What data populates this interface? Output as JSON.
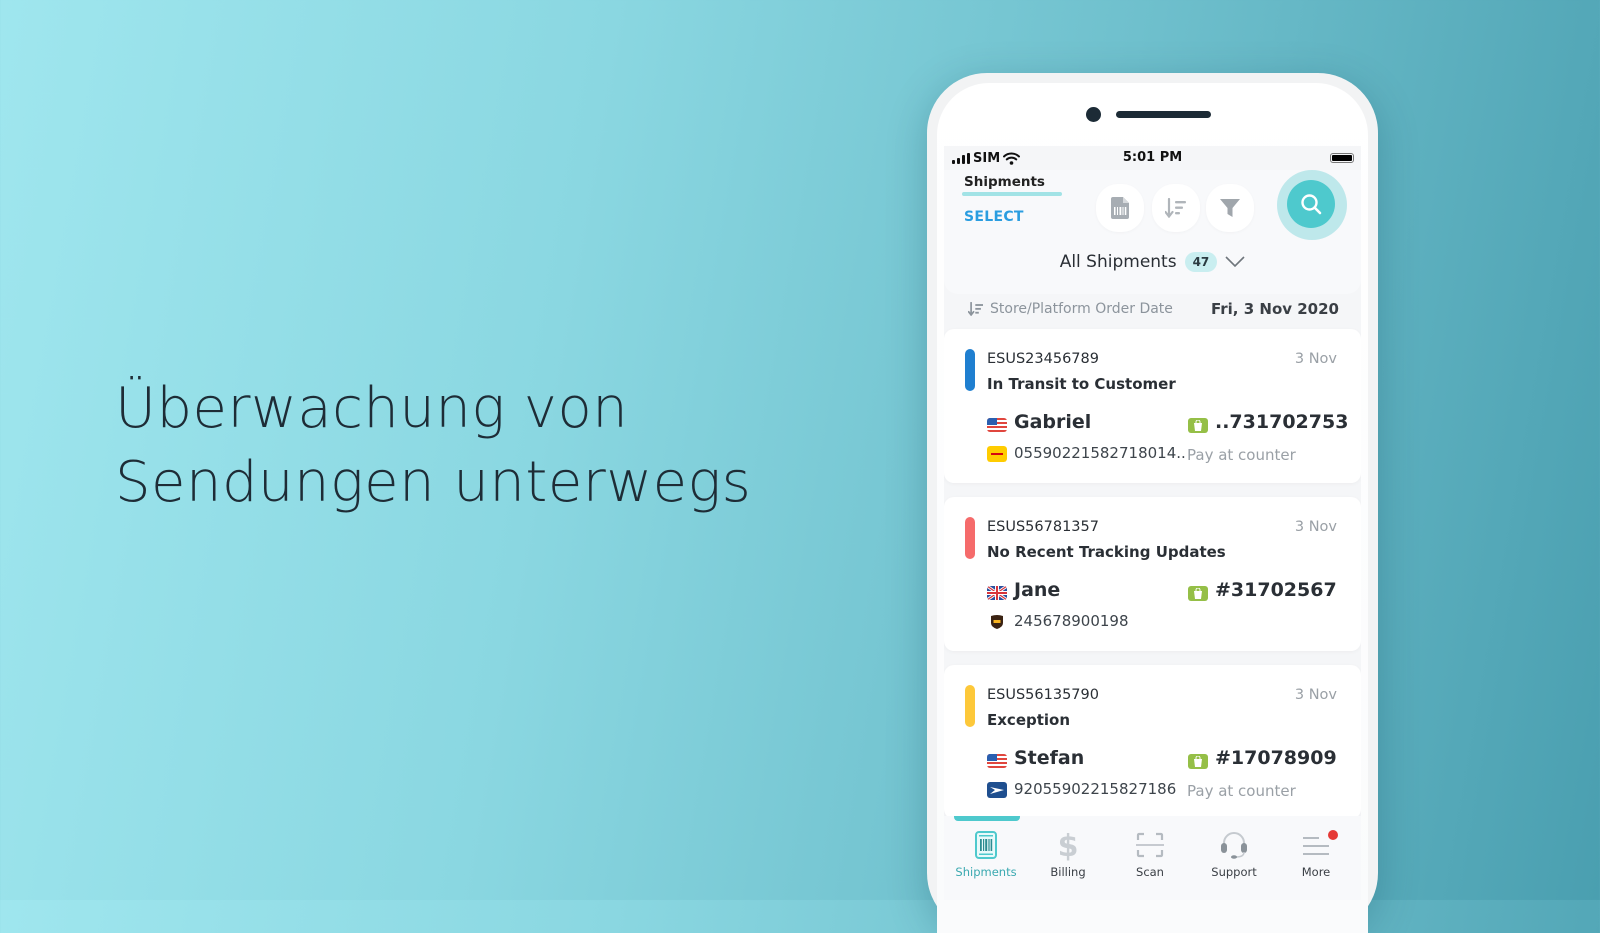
{
  "headline": {
    "line1": "Überwachung von",
    "line2": "Sendungen unterwegs"
  },
  "status_bar": {
    "carrier": "SIM",
    "time": "5:01 PM",
    "icons": [
      "signal-icon",
      "wifi-icon",
      "battery-icon"
    ]
  },
  "header": {
    "tab_label": "Shipments",
    "select_label": "SELECT",
    "tools": [
      "barcode-document-icon",
      "sort-icon",
      "filter-icon",
      "search-icon"
    ],
    "filter_label": "All Shipments",
    "filter_count": "47"
  },
  "sort": {
    "label": "Store/Platform Order Date",
    "date": "Fri, 3 Nov 2020"
  },
  "colors": {
    "accent": "#4ec9cd",
    "select_blue": "#2a9de0",
    "in_transit": "#1f7fd0",
    "no_updates": "#f56b6b",
    "exception": "#fdc83a",
    "shopify_green": "#95bf47",
    "notification_red": "#e53935"
  },
  "shipments": [
    {
      "id": "ESUS23456789",
      "date": "3 Nov",
      "status": "In Transit to Customer",
      "status_color": "#1f7fd0",
      "country_flag": "us-flag-icon",
      "name": "Gabriel",
      "carrier": "dhl-icon",
      "tracking": "05590221582718014..",
      "store": "shopify-icon",
      "order": "..731702753",
      "payment": "Pay at counter"
    },
    {
      "id": "ESUS56781357",
      "date": "3 Nov",
      "status": "No Recent Tracking Updates",
      "status_color": "#f56b6b",
      "country_flag": "uk-flag-icon",
      "name": "Jane",
      "carrier": "ups-icon",
      "tracking": "245678900198",
      "store": "shopify-icon",
      "order": "#31702567",
      "payment": ""
    },
    {
      "id": "ESUS56135790",
      "date": "3 Nov",
      "status": "Exception",
      "status_color": "#fdc83a",
      "country_flag": "us-flag-icon",
      "name": "Stefan",
      "carrier": "usps-icon",
      "tracking": "92055902215827186",
      "store": "shopify-icon",
      "order": "#17078909",
      "payment": "Pay at counter"
    }
  ],
  "bottom_nav": [
    {
      "label": "Shipments",
      "icon": "shipments-barcode-icon",
      "active": true
    },
    {
      "label": "Billing",
      "icon": "dollar-icon",
      "active": false
    },
    {
      "label": "Scan",
      "icon": "scan-icon",
      "active": false
    },
    {
      "label": "Support",
      "icon": "headset-icon",
      "active": false
    },
    {
      "label": "More",
      "icon": "menu-icon",
      "active": false,
      "notification": true
    }
  ]
}
